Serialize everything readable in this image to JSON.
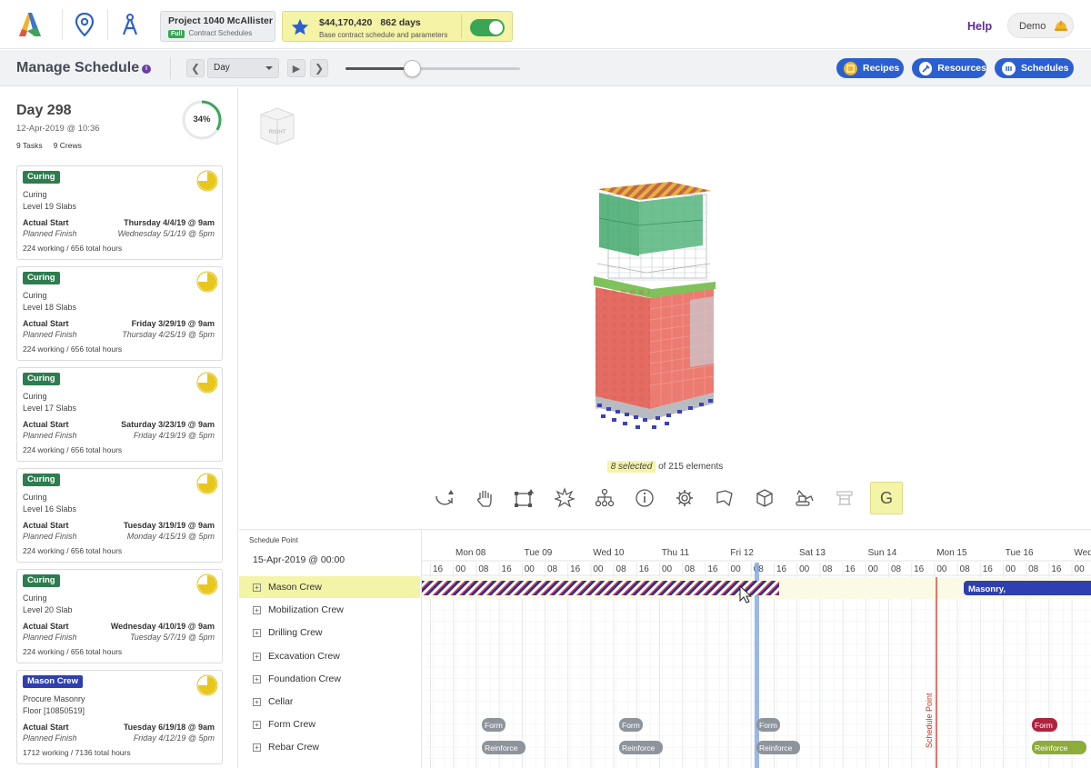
{
  "app": {
    "project_name": "Project 1040 McAllister",
    "project_badge": "Full",
    "project_sub": "Contract Schedules",
    "budget_amount": "$44,170,420",
    "budget_days": "862 days",
    "budget_sub": "Base contract schedule and parameters",
    "help_label": "Help",
    "demo_label": "Demo",
    "colors": {
      "brand_purple": "#5a2c91",
      "accent_blue": "#2b5fd0",
      "green": "#3aa655",
      "highlight_yellow": "#f3f4a6"
    }
  },
  "toolbar": {
    "title": "Manage Schedule",
    "view_mode": "Day",
    "slider_value": 0.38,
    "buttons": [
      {
        "label": "Recipes",
        "icon": "recipes-icon"
      },
      {
        "label": "Resources",
        "icon": "resources-icon"
      },
      {
        "label": "Schedules",
        "icon": "schedules-icon"
      }
    ]
  },
  "day": {
    "title": "Day 298",
    "date": "12-Apr-2019 @ 10:36",
    "tasks": "9 Tasks",
    "crews": "9 Crews",
    "progress": "34%",
    "progress_value": 0.34
  },
  "tasks": [
    {
      "badge": "Curing",
      "badge_color": "#2e7d4f",
      "line1": "Curing",
      "line2": "Level 19 Slabs",
      "start_label": "Actual Start",
      "start": "Thursday 4/4/19 @ 9am",
      "finish_label": "Planned Finish",
      "finish": "Wednesday 5/1/19 @ 5pm",
      "hours": "224 working / 656 total hours",
      "pie": 0.75
    },
    {
      "badge": "Curing",
      "badge_color": "#2e7d4f",
      "line1": "Curing",
      "line2": "Level 18 Slabs",
      "start_label": "Actual Start",
      "start": "Friday 3/29/19 @ 9am",
      "finish_label": "Planned Finish",
      "finish": "Thursday 4/25/19 @ 5pm",
      "hours": "224 working / 656 total hours",
      "pie": 0.75
    },
    {
      "badge": "Curing",
      "badge_color": "#2e7d4f",
      "line1": "Curing",
      "line2": "Level 17 Slabs",
      "start_label": "Actual Start",
      "start": "Saturday 3/23/19 @ 9am",
      "finish_label": "Planned Finish",
      "finish": "Friday 4/19/19 @ 5pm",
      "hours": "224 working / 656 total hours",
      "pie": 0.75
    },
    {
      "badge": "Curing",
      "badge_color": "#2e7d4f",
      "line1": "Curing",
      "line2": "Level 16 Slabs",
      "start_label": "Actual Start",
      "start": "Tuesday 3/19/19 @ 9am",
      "finish_label": "Planned Finish",
      "finish": "Monday 4/15/19 @ 5pm",
      "hours": "224 working / 656 total hours",
      "pie": 0.75
    },
    {
      "badge": "Curing",
      "badge_color": "#2e7d4f",
      "line1": "Curing",
      "line2": "Level 20 Slab",
      "start_label": "Actual Start",
      "start": "Wednesday 4/10/19 @ 9am",
      "finish_label": "Planned Finish",
      "finish": "Tuesday 5/7/19 @ 5pm",
      "hours": "224 working / 656 total hours",
      "pie": 0.75
    },
    {
      "badge": "Mason Crew",
      "badge_color": "#2f3fb0",
      "line1": "Procure Masonry",
      "line2": "Floor [10850519]",
      "start_label": "Actual Start",
      "start": "Tuesday 6/19/18 @ 9am",
      "finish_label": "Planned Finish",
      "finish": "Friday 4/12/19 @ 5pm",
      "hours": "1712 working / 7136 total hours",
      "pie": 0.75
    }
  ],
  "viewer": {
    "cube_label": "RIGHT",
    "selected": "8 selected",
    "total": "of 215 elements",
    "tools": [
      "rotate-icon",
      "pan-hand-icon",
      "box-select-icon",
      "explode-icon",
      "hierarchy-icon",
      "info-icon",
      "settings-gear-icon",
      "flag-icon",
      "cube-icon",
      "excavator-icon",
      "crane-icon"
    ],
    "active_tool_label": "G"
  },
  "gantt": {
    "schedule_point_label": "Schedule Point",
    "schedule_point_date": "15-Apr-2019 @ 00:00",
    "schedule_point_marker": "Schedule Point",
    "days": [
      "Mon 08",
      "Tue 09",
      "Wed 10",
      "Thu 11",
      "Fri 12",
      "Sat 13",
      "Sun 14",
      "Mon 15",
      "Tue 16",
      "Wed"
    ],
    "hours": [
      "16",
      "00",
      "08",
      "16",
      "00",
      "08",
      "16",
      "00",
      "08",
      "16",
      "00",
      "08",
      "16",
      "00",
      "08",
      "16",
      "00",
      "08",
      "16",
      "00",
      "08",
      "16",
      "00",
      "08",
      "16",
      "00",
      "08",
      "16",
      "00",
      "08"
    ],
    "crews": [
      "Mason Crew",
      "Mobilization Crew",
      "Drilling Crew",
      "Excavation Crew",
      "Foundation Crew",
      "Cellar",
      "Form Crew",
      "Rebar Crew"
    ],
    "masonry_label": "Masonry,",
    "form_label": "Form",
    "reinforce_label": "Reinforce"
  }
}
